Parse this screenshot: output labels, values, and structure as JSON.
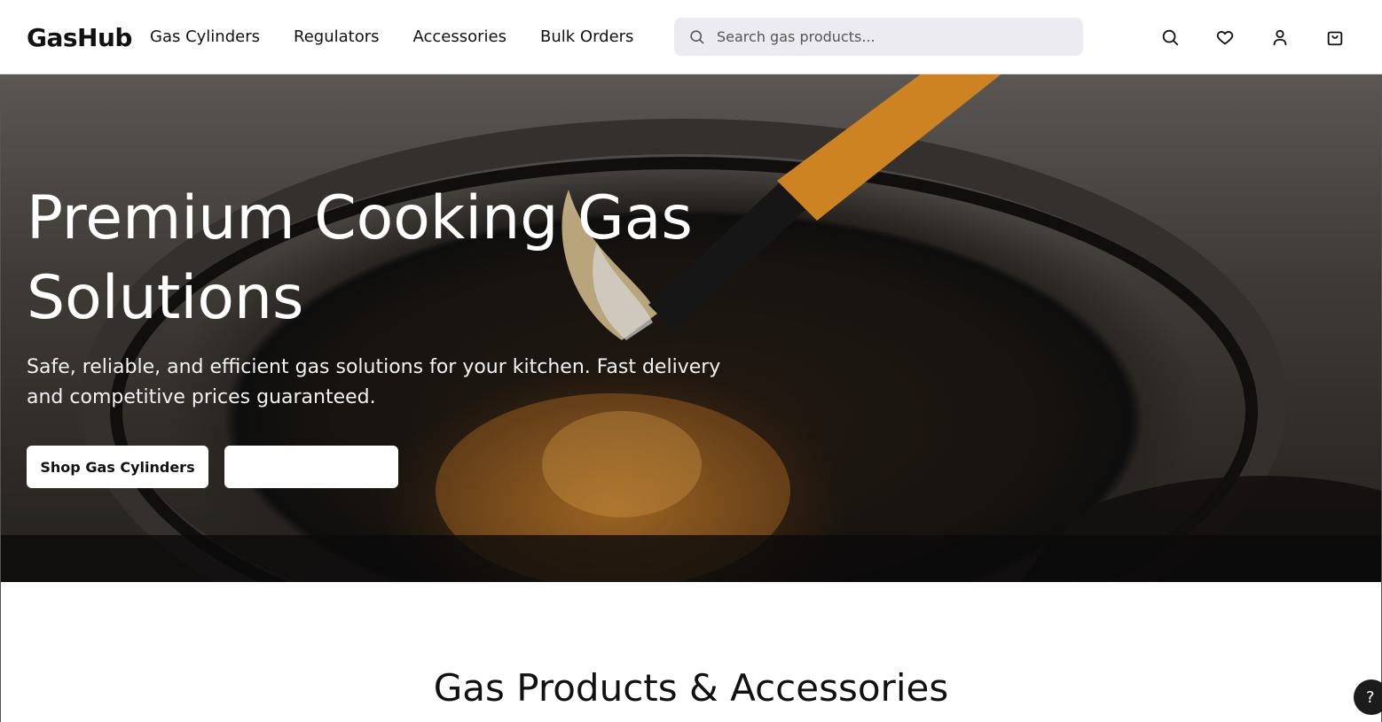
{
  "header": {
    "logo": "GasHub",
    "nav": [
      "Gas Cylinders",
      "Regulators",
      "Accessories",
      "Bulk Orders"
    ],
    "search_placeholder": "Search gas products...",
    "icons": [
      "search-icon",
      "heart-icon",
      "user-icon",
      "shopping-bag-icon"
    ]
  },
  "hero": {
    "title": "Premium Cooking Gas Solutions",
    "subtitle": "Safe, reliable, and efficient gas solutions for your kitchen. Fast delivery and competitive prices guaranteed.",
    "primary_button": "Shop Gas Cylinders",
    "secondary_button": ""
  },
  "section": {
    "title": "Gas Products & Accessories"
  },
  "help_button": "?",
  "colors": {
    "primary_text": "#111111",
    "search_bg": "#ececf0",
    "lighter_orange": "#f39a2a"
  }
}
